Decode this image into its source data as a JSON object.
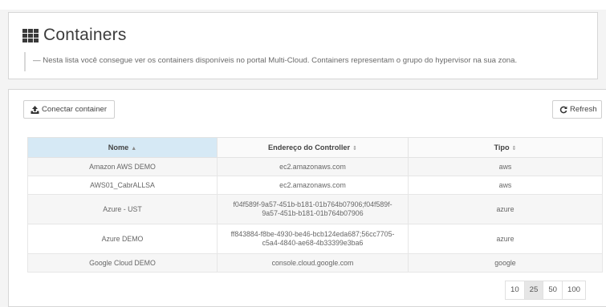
{
  "header": {
    "title": "Containers",
    "icon": "grid-icon",
    "description": "— Nesta lista você consegue ver os containers disponíveis no portal Multi-Cloud. Containers representam o grupo do hypervisor na sua zona."
  },
  "toolbar": {
    "connect_label": "Conectar container",
    "connect_icon": "upload-icon",
    "refresh_label": "Refresh",
    "refresh_icon": "refresh-icon"
  },
  "table": {
    "columns": [
      "Nome",
      "Endereço do Controller",
      "Tipo"
    ],
    "sort_indicators": [
      "▲",
      "⇕",
      "⇕"
    ],
    "rows": [
      {
        "nome": "Amazon AWS DEMO",
        "controller": [
          "ec2.amazonaws.com"
        ],
        "tipo": "aws"
      },
      {
        "nome": "AWS01_CabrALLSA",
        "controller": [
          "ec2.amazonaws.com"
        ],
        "tipo": "aws"
      },
      {
        "nome": "Azure - UST",
        "controller": [
          "f04f589f-9a57-451b-b181-01b764b07906;f04f589f-",
          "9a57-451b-b181-01b764b07906"
        ],
        "tipo": "azure"
      },
      {
        "nome": "Azure DEMO",
        "controller": [
          "ff843884-f8be-4930-be46-bcb124eda687;56cc7705-",
          "c5a4-4840-ae68-4b33399e3ba6"
        ],
        "tipo": "azure"
      },
      {
        "nome": "Google Cloud DEMO",
        "controller": [
          "console.cloud.google.com"
        ],
        "tipo": "google"
      }
    ]
  },
  "pagination": {
    "options": [
      "10",
      "25",
      "50",
      "100"
    ],
    "selected": "25"
  },
  "colors": {
    "sorted_header": "#d6e9f5",
    "row_alt": "#f6f6f6",
    "border": "#d6d6d6"
  }
}
